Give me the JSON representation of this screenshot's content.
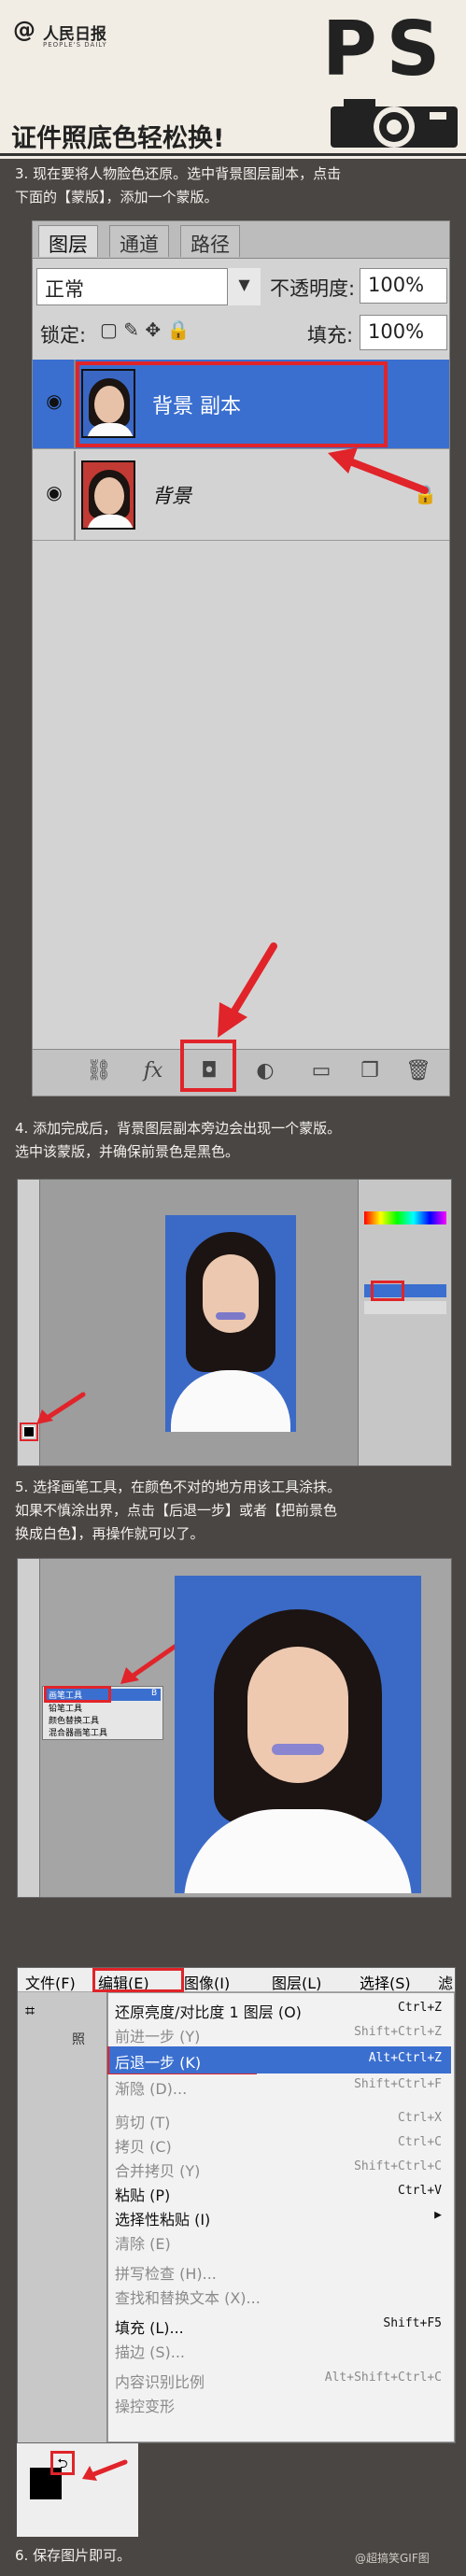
{
  "header": {
    "logo_mark": "@",
    "logo_cn": "人民日报",
    "logo_en": "PEOPLE'S DAILY",
    "ps_text": "PS",
    "title": "证件照底色轻松换!"
  },
  "steps": {
    "s3_line1": "3. 现在要将人物脸色还原。选中背景图层副本，点击",
    "s3_line2": "下面的【蒙版】，添加一个蒙版。",
    "s4_line1": "4. 添加完成后，背景图层副本旁边会出现一个蒙版。",
    "s4_line2": "选中该蒙版，并确保前景色是黑色。",
    "s5_line1": "5. 选择画笔工具，在颜色不对的地方用该工具涂抹。",
    "s5_line2": "如果不慎涂出界，点击【后退一步】或者【把前景色",
    "s5_line3": "换成白色】，再操作就可以了。",
    "s6_line1": "6. 保存图片即可。"
  },
  "layers_panel": {
    "tabs": [
      "图层",
      "通道",
      "路径"
    ],
    "blend_mode": "正常",
    "opacity_label": "不透明度:",
    "opacity_value": "100%",
    "lock_label": "锁定:",
    "fill_label": "填充:",
    "fill_value": "100%",
    "layers": [
      {
        "name": "背景 副本",
        "selected": true
      },
      {
        "name": "背景",
        "selected": false,
        "locked": true
      }
    ],
    "bottom_icons": [
      "link-icon",
      "fx-icon",
      "mask-icon",
      "adjustment-icon",
      "folder-icon",
      "new-layer-icon",
      "trash-icon"
    ],
    "fx_label": "fx"
  },
  "brush_popup": {
    "items": [
      "画笔工具",
      "铅笔工具",
      "颜色替换工具",
      "混合器画笔工具"
    ],
    "shortcut": "B"
  },
  "edit_menu": {
    "menubar": [
      "文件(F)",
      "编辑(E)",
      "图像(I)",
      "图层(L)",
      "选择(S)",
      "滤"
    ],
    "side_label": "照",
    "items": [
      {
        "label": "还原亮度/对比度 1 图层 (O)",
        "shortcut": "Ctrl+Z",
        "disabled": false
      },
      {
        "label": "前进一步 (Y)",
        "shortcut": "Shift+Ctrl+Z",
        "disabled": true
      },
      {
        "label": "后退一步 (K)",
        "shortcut": "Alt+Ctrl+Z",
        "disabled": false,
        "highlighted": true
      },
      {
        "label": "渐隐 (D)...",
        "shortcut": "Shift+Ctrl+F",
        "disabled": true
      },
      {
        "label": "剪切 (T)",
        "shortcut": "Ctrl+X",
        "disabled": true
      },
      {
        "label": "拷贝 (C)",
        "shortcut": "Ctrl+C",
        "disabled": true
      },
      {
        "label": "合并拷贝 (Y)",
        "shortcut": "Shift+Ctrl+C",
        "disabled": true
      },
      {
        "label": "粘贴 (P)",
        "shortcut": "Ctrl+V",
        "disabled": false
      },
      {
        "label": "选择性粘贴 (I)",
        "shortcut": "",
        "disabled": false,
        "submenu": true
      },
      {
        "label": "清除 (E)",
        "shortcut": "",
        "disabled": true
      },
      {
        "label": "拼写检查 (H)...",
        "shortcut": "",
        "disabled": true
      },
      {
        "label": "查找和替换文本 (X)...",
        "shortcut": "",
        "disabled": true
      },
      {
        "label": "填充 (L)...",
        "shortcut": "Shift+F5",
        "disabled": false
      },
      {
        "label": "描边 (S)...",
        "shortcut": "",
        "disabled": true
      },
      {
        "label": "内容识别比例",
        "shortcut": "Alt+Shift+Ctrl+C",
        "disabled": true
      },
      {
        "label": "操控变形",
        "shortcut": "",
        "disabled": true
      }
    ]
  },
  "footer": {
    "weibo": "@超搞笑GIF图"
  },
  "colors": {
    "background": "#4a4643",
    "header_bg": "#f1ede4",
    "highlight_red": "#e0242a",
    "selection_blue": "#3a6fd0",
    "photo_blue": "#3b6ac6"
  }
}
